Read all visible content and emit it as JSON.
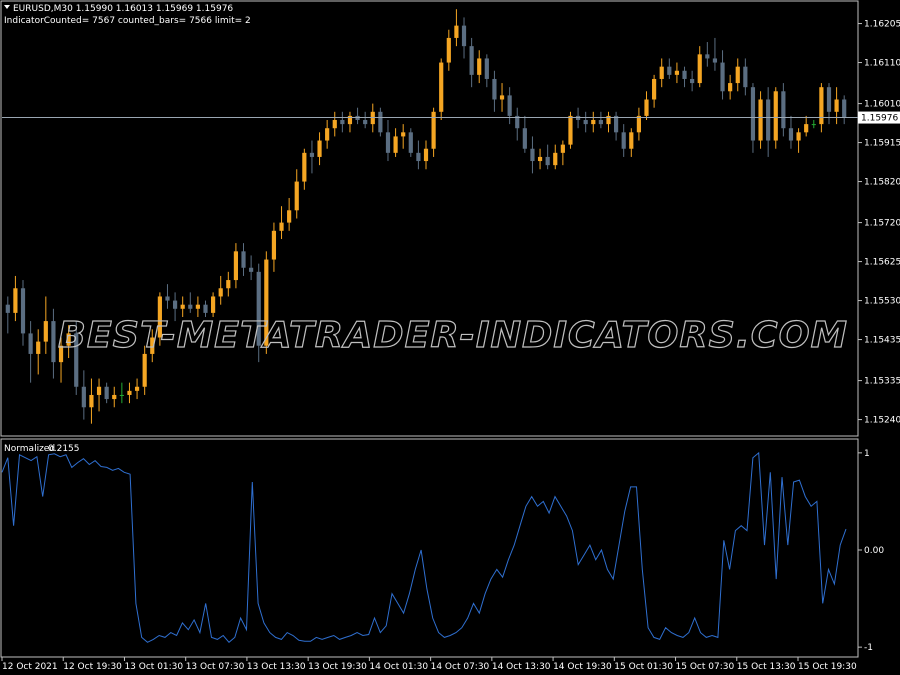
{
  "header": {
    "symbol_info": "EURUSD,M30  1.15990 1.16013 1.15969 1.15976",
    "indicator_info": "IndicatorCounted= 7567   counted_bars= 7566   limit= 2"
  },
  "watermark": "BEST-METATRADER-INDICATORS.COM",
  "colors": {
    "background": "#000000",
    "frame": "#c0c0c0",
    "bull": "#f5a623",
    "bear": "#5b6e82",
    "doji": "#22aa33",
    "indicator_line": "#2f6fd0",
    "current_price_line": "#9aa6b2",
    "label_bg": "#ffffff",
    "label_text": "#000000"
  },
  "chart_data": [
    {
      "type": "candlestick",
      "ylim": [
        1.152,
        1.1626
      ],
      "current_price": "1.15976",
      "yticks": [
        "1.16205",
        "1.16110",
        "1.16010",
        "1.15915",
        "1.15820",
        "1.15720",
        "1.15625",
        "1.15530",
        "1.15435",
        "1.15335",
        "1.15240"
      ],
      "ohlc": [
        [
          1.1552,
          1.1554,
          1.1545,
          1.155
        ],
        [
          1.155,
          1.1559,
          1.1548,
          1.1556
        ],
        [
          1.1556,
          1.1558,
          1.1542,
          1.1545
        ],
        [
          1.1545,
          1.1548,
          1.1533,
          1.154
        ],
        [
          1.154,
          1.1546,
          1.1535,
          1.1543
        ],
        [
          1.1543,
          1.1554,
          1.154,
          1.1548
        ],
        [
          1.1548,
          1.1551,
          1.1534,
          1.1538
        ],
        [
          1.1538,
          1.1544,
          1.1533,
          1.1542
        ],
        [
          1.1542,
          1.1547,
          1.1539,
          1.1545
        ],
        [
          1.1545,
          1.1548,
          1.153,
          1.1532
        ],
        [
          1.1532,
          1.1536,
          1.1524,
          1.1527
        ],
        [
          1.1527,
          1.1534,
          1.1523,
          1.153
        ],
        [
          1.153,
          1.1534,
          1.1526,
          1.1532
        ],
        [
          1.1532,
          1.1533,
          1.1528,
          1.1529
        ],
        [
          1.1529,
          1.1532,
          1.1527,
          1.153
        ],
        [
          1.153,
          1.1533,
          1.1528,
          1.153
        ],
        [
          1.153,
          1.1533,
          1.1528,
          1.1531
        ],
        [
          1.1531,
          1.1534,
          1.1529,
          1.1532
        ],
        [
          1.1532,
          1.1542,
          1.153,
          1.154
        ],
        [
          1.154,
          1.1546,
          1.1538,
          1.1544
        ],
        [
          1.1544,
          1.1555,
          1.1542,
          1.1554
        ],
        [
          1.1554,
          1.1557,
          1.1551,
          1.1553
        ],
        [
          1.1553,
          1.1555,
          1.1548,
          1.1551
        ],
        [
          1.1551,
          1.1554,
          1.1549,
          1.1552
        ],
        [
          1.1552,
          1.1555,
          1.155,
          1.1551
        ],
        [
          1.1551,
          1.1554,
          1.1549,
          1.1552
        ],
        [
          1.1552,
          1.1553,
          1.1549,
          1.155
        ],
        [
          1.155,
          1.1555,
          1.1549,
          1.1554
        ],
        [
          1.1554,
          1.1559,
          1.1552,
          1.1556
        ],
        [
          1.1556,
          1.156,
          1.1554,
          1.1558
        ],
        [
          1.1558,
          1.1567,
          1.1556,
          1.1565
        ],
        [
          1.1565,
          1.1567,
          1.1559,
          1.1561
        ],
        [
          1.1561,
          1.1564,
          1.1558,
          1.156
        ],
        [
          1.156,
          1.1562,
          1.1538,
          1.1542
        ],
        [
          1.1542,
          1.1565,
          1.154,
          1.1563
        ],
        [
          1.1563,
          1.1572,
          1.156,
          1.157
        ],
        [
          1.157,
          1.1576,
          1.1568,
          1.1572
        ],
        [
          1.1572,
          1.1578,
          1.157,
          1.1575
        ],
        [
          1.1575,
          1.1585,
          1.1573,
          1.1582
        ],
        [
          1.1582,
          1.159,
          1.158,
          1.1589
        ],
        [
          1.1589,
          1.1592,
          1.1584,
          1.1588
        ],
        [
          1.1588,
          1.1594,
          1.1586,
          1.1592
        ],
        [
          1.1592,
          1.1597,
          1.159,
          1.1595
        ],
        [
          1.1595,
          1.1599,
          1.1593,
          1.1597
        ],
        [
          1.1597,
          1.1599,
          1.1594,
          1.1596
        ],
        [
          1.1596,
          1.1599,
          1.1594,
          1.1598
        ],
        [
          1.1598,
          1.16,
          1.1596,
          1.1597
        ],
        [
          1.1597,
          1.1599,
          1.1595,
          1.1596
        ],
        [
          1.1596,
          1.1601,
          1.1594,
          1.1599
        ],
        [
          1.1599,
          1.16,
          1.1593,
          1.1594
        ],
        [
          1.1594,
          1.1597,
          1.1587,
          1.1589
        ],
        [
          1.1589,
          1.1595,
          1.1588,
          1.1593
        ],
        [
          1.1593,
          1.1596,
          1.159,
          1.1594
        ],
        [
          1.1594,
          1.1595,
          1.1588,
          1.1589
        ],
        [
          1.1589,
          1.1592,
          1.1585,
          1.1587
        ],
        [
          1.1587,
          1.1592,
          1.1585,
          1.159
        ],
        [
          1.159,
          1.16,
          1.1588,
          1.1599
        ],
        [
          1.1599,
          1.1612,
          1.1597,
          1.1611
        ],
        [
          1.1611,
          1.1619,
          1.1609,
          1.1617
        ],
        [
          1.1617,
          1.1624,
          1.1615,
          1.162
        ],
        [
          1.162,
          1.1622,
          1.1612,
          1.1615
        ],
        [
          1.1615,
          1.1617,
          1.1605,
          1.1608
        ],
        [
          1.1608,
          1.1614,
          1.1606,
          1.1612
        ],
        [
          1.1612,
          1.1613,
          1.1605,
          1.1607
        ],
        [
          1.1607,
          1.1609,
          1.1599,
          1.1602
        ],
        [
          1.1602,
          1.1606,
          1.1599,
          1.1603
        ],
        [
          1.1603,
          1.1605,
          1.1596,
          1.1598
        ],
        [
          1.1598,
          1.16,
          1.1592,
          1.1595
        ],
        [
          1.1595,
          1.1598,
          1.1589,
          1.159
        ],
        [
          1.159,
          1.1593,
          1.1584,
          1.1587
        ],
        [
          1.1587,
          1.159,
          1.1585,
          1.1588
        ],
        [
          1.1588,
          1.1591,
          1.1585,
          1.1586
        ],
        [
          1.1586,
          1.1591,
          1.1585,
          1.1589
        ],
        [
          1.1589,
          1.1592,
          1.1586,
          1.1591
        ],
        [
          1.1591,
          1.1599,
          1.159,
          1.1598
        ],
        [
          1.1598,
          1.16,
          1.1595,
          1.1597
        ],
        [
          1.1597,
          1.1599,
          1.1594,
          1.1596
        ],
        [
          1.1596,
          1.1599,
          1.1594,
          1.1597
        ],
        [
          1.1597,
          1.1599,
          1.1595,
          1.1596
        ],
        [
          1.1596,
          1.1599,
          1.1594,
          1.1598
        ],
        [
          1.1598,
          1.1599,
          1.1592,
          1.1594
        ],
        [
          1.1594,
          1.1596,
          1.1588,
          1.159
        ],
        [
          1.159,
          1.1595,
          1.1588,
          1.1594
        ],
        [
          1.1594,
          1.16,
          1.1592,
          1.1598
        ],
        [
          1.1598,
          1.1604,
          1.1597,
          1.1602
        ],
        [
          1.1602,
          1.1608,
          1.16,
          1.1607
        ],
        [
          1.1607,
          1.1612,
          1.1605,
          1.161
        ],
        [
          1.161,
          1.1612,
          1.1607,
          1.1608
        ],
        [
          1.1608,
          1.1611,
          1.1606,
          1.1609
        ],
        [
          1.1609,
          1.161,
          1.1605,
          1.1607
        ],
        [
          1.1607,
          1.1609,
          1.1604,
          1.1606
        ],
        [
          1.1606,
          1.1615,
          1.1605,
          1.1613
        ],
        [
          1.1613,
          1.1616,
          1.161,
          1.1612
        ],
        [
          1.1612,
          1.1617,
          1.1609,
          1.1611
        ],
        [
          1.1611,
          1.1614,
          1.1602,
          1.1604
        ],
        [
          1.1604,
          1.1608,
          1.1602,
          1.1606
        ],
        [
          1.1606,
          1.1612,
          1.1604,
          1.161
        ],
        [
          1.161,
          1.1612,
          1.1603,
          1.1605
        ],
        [
          1.1605,
          1.1606,
          1.1589,
          1.1592
        ],
        [
          1.1592,
          1.1604,
          1.159,
          1.1602
        ],
        [
          1.1602,
          1.1605,
          1.1588,
          1.1592
        ],
        [
          1.1592,
          1.1605,
          1.159,
          1.1604
        ],
        [
          1.1604,
          1.1606,
          1.1593,
          1.1595
        ],
        [
          1.1595,
          1.1598,
          1.159,
          1.1592
        ],
        [
          1.1592,
          1.1595,
          1.1589,
          1.1594
        ],
        [
          1.1594,
          1.1598,
          1.1593,
          1.1596
        ],
        [
          1.1596,
          1.1597,
          1.1595,
          1.1596
        ],
        [
          1.1596,
          1.1606,
          1.1594,
          1.1605
        ],
        [
          1.1605,
          1.1606,
          1.1596,
          1.1599
        ],
        [
          1.1599,
          1.1605,
          1.1596,
          1.1602
        ],
        [
          1.1602,
          1.1603,
          1.1596,
          1.15976
        ]
      ]
    },
    {
      "type": "line",
      "title": "Normalized",
      "last_value": "0.2155",
      "ylim": [
        -1.05,
        1.05
      ],
      "yticks": [
        "1",
        "0.00",
        "-1"
      ],
      "xticks": [
        "12 Oct 2021",
        "12 Oct 19:30",
        "13 Oct 01:30",
        "13 Oct 07:30",
        "13 Oct 13:30",
        "13 Oct 19:30",
        "14 Oct 01:30",
        "14 Oct 07:30",
        "14 Oct 13:30",
        "14 Oct 19:30",
        "15 Oct 01:30",
        "15 Oct 07:30",
        "15 Oct 13:30",
        "15 Oct 19:30"
      ],
      "series": [
        {
          "values": [
            0.8,
            0.95,
            0.25,
            0.98,
            0.95,
            0.92,
            0.96,
            0.55,
            0.98,
            0.99,
            0.96,
            0.98,
            0.85,
            0.9,
            0.94,
            0.88,
            0.92,
            0.86,
            0.85,
            0.82,
            0.84,
            0.8,
            0.78,
            -0.55,
            -0.9,
            -0.95,
            -0.92,
            -0.88,
            -0.9,
            -0.85,
            -0.88,
            -0.75,
            -0.82,
            -0.72,
            -0.85,
            -0.55,
            -0.9,
            -0.92,
            -0.88,
            -0.95,
            -0.9,
            -0.7,
            -0.82,
            0.7,
            -0.55,
            -0.75,
            -0.85,
            -0.9,
            -0.92,
            -0.85,
            -0.88,
            -0.93,
            -0.94,
            -0.94,
            -0.9,
            -0.92,
            -0.9,
            -0.88,
            -0.92,
            -0.9,
            -0.88,
            -0.85,
            -0.88,
            -0.87,
            -0.7,
            -0.85,
            -0.78,
            -0.45,
            -0.55,
            -0.65,
            -0.45,
            -0.2,
            0.0,
            -0.4,
            -0.7,
            -0.85,
            -0.9,
            -0.88,
            -0.85,
            -0.8,
            -0.7,
            -0.55,
            -0.65,
            -0.45,
            -0.3,
            -0.2,
            -0.28,
            -0.1,
            0.05,
            0.25,
            0.45,
            0.55,
            0.45,
            0.5,
            0.38,
            0.55,
            0.45,
            0.35,
            0.2,
            -0.15,
            -0.05,
            0.05,
            -0.1,
            0.0,
            -0.2,
            -0.3,
            0.05,
            0.4,
            0.65,
            0.65,
            -0.2,
            -0.8,
            -0.9,
            -0.92,
            -0.8,
            -0.85,
            -0.88,
            -0.9,
            -0.85,
            -0.7,
            -0.85,
            -0.9,
            -0.88,
            -0.9,
            0.1,
            -0.2,
            0.2,
            0.25,
            0.2,
            0.95,
            1.0,
            0.05,
            0.8,
            -0.3,
            0.75,
            0.05,
            0.7,
            0.72,
            0.55,
            0.45,
            0.5,
            -0.55,
            -0.2,
            -0.35,
            0.05,
            0.2155
          ]
        }
      ]
    }
  ]
}
